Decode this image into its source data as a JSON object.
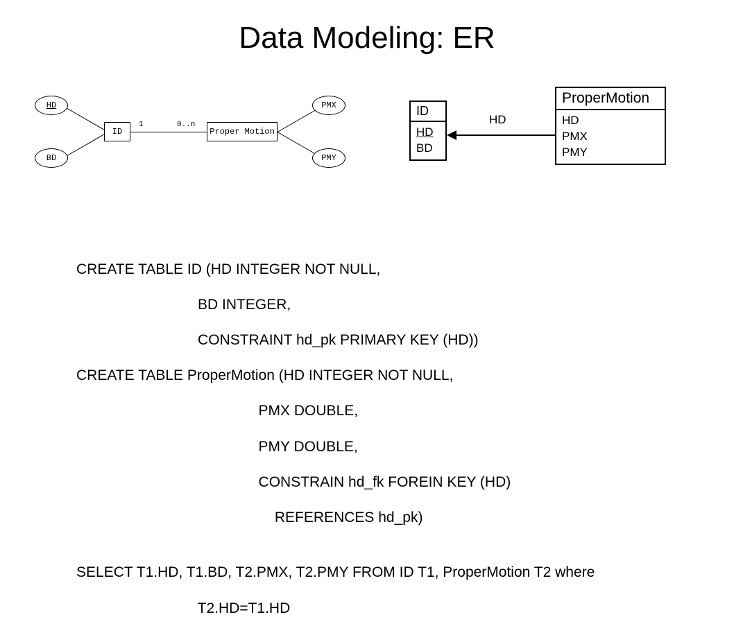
{
  "title": "Data Modeling: ER",
  "er": {
    "attrHD": "HD",
    "attrBD": "BD",
    "entityID": "ID",
    "card1": "1",
    "cardN": "0..n",
    "relPM": "Proper Motion",
    "attrPMX": "PMX",
    "attrPMY": "PMY"
  },
  "schema": {
    "left": {
      "title": "ID",
      "row1": "HD",
      "row2": "BD"
    },
    "relLabel": "HD",
    "right": {
      "title": "ProperMotion",
      "row1": "HD",
      "row2": "PMX",
      "row3": "PMY"
    }
  },
  "sql": {
    "l1": "CREATE TABLE ID (HD INTEGER NOT NULL,",
    "l2": "                              BD INTEGER,",
    "l3": "                              CONSTRAINT hd_pk PRIMARY KEY (HD))",
    "l4": "CREATE TABLE ProperMotion (HD INTEGER NOT NULL,",
    "l5": "                                             PMX DOUBLE,",
    "l6": "                                             PMY DOUBLE,",
    "l7": "                                             CONSTRAIN hd_fk FOREIN KEY (HD)",
    "l8": "                                                 REFERENCES hd_pk)",
    "q1": "SELECT T1.HD, T1.BD, T2.PMX, T2.PMY FROM ID T1, ProperMotion T2 where",
    "q2": "                              T2.HD=T1.HD"
  }
}
